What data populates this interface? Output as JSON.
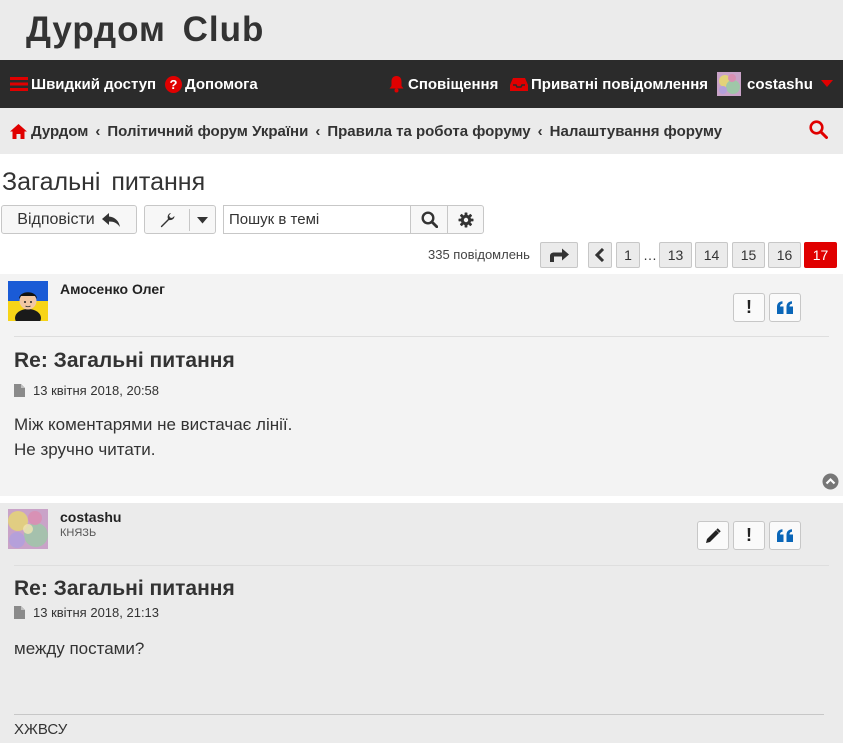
{
  "site": {
    "title": "Дурдом Club"
  },
  "navbar": {
    "quick_access": "Швидкий доступ",
    "help": "Допомога",
    "notifications": "Сповіщення",
    "private_messages": "Приватні повідомлення",
    "username": "costashu"
  },
  "breadcrumbs": [
    "Дурдом",
    "Політичний форум України",
    "Правила та робота форуму",
    "Налаштування форуму"
  ],
  "topic": {
    "title": "Загальні питання"
  },
  "toolbar": {
    "reply_label": "Відповісти",
    "search_placeholder": "Пошук в темі"
  },
  "pagination": {
    "count_label": "335 повідомлень",
    "pages": [
      "1",
      "13",
      "14",
      "15",
      "16",
      "17"
    ],
    "ellipsis": "…",
    "current": "17"
  },
  "posts": [
    {
      "author": "Амосенко Олег",
      "rank": "",
      "title": "Re: Загальні питання",
      "date": "13 квітня 2018, 20:58",
      "body_lines": [
        "Між коментарями не вистачає лінії.",
        "Не зручно читати."
      ],
      "signature": ""
    },
    {
      "author": "costashu",
      "rank": "КНЯЗЬ",
      "title": "Re: Загальні питання",
      "date": "13 квітня 2018, 21:13",
      "body_lines": [
        "между постами?"
      ],
      "signature": "ХЖВСУ"
    }
  ],
  "colors": {
    "accent": "#e00000",
    "navbar_bg": "#2b2b2b",
    "quote_blue": "#0a66b8"
  }
}
